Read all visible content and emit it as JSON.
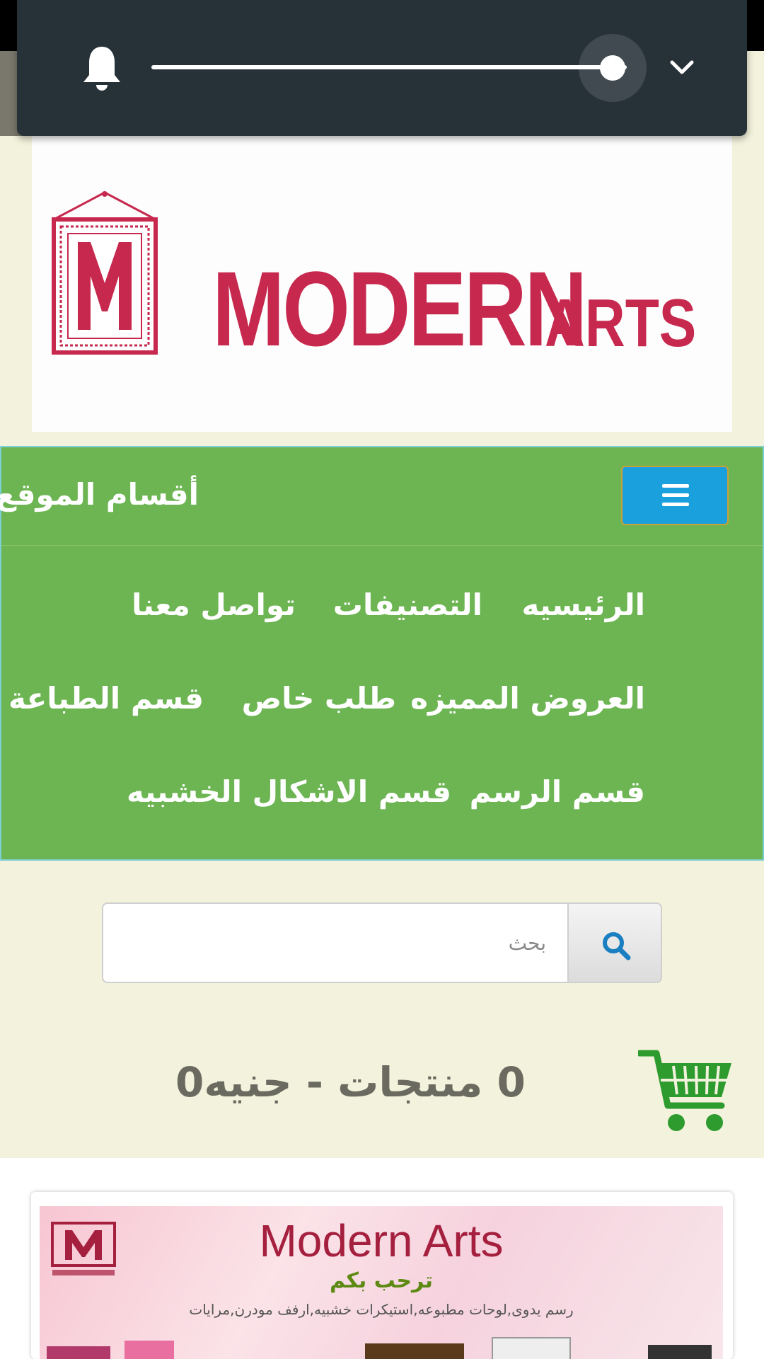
{
  "logo": {
    "word1": "MODERN",
    "word2": "ARTS",
    "letter": "M",
    "color": "#c7284e"
  },
  "nav": {
    "title": "أقسام الموقع",
    "links": [
      "الرئيسيه",
      "التصنيفات",
      "تواصل معنا",
      "العروض المميزه",
      "طلب خاص",
      "قسم الطباعة",
      "قسم الرسم",
      "قسم الاشكال الخشبيه"
    ],
    "bg_color": "#6cb552",
    "menu_button_color": "#1aa0dd"
  },
  "search": {
    "placeholder": "بحث",
    "icon": "search-icon"
  },
  "cart": {
    "summary": "0 منتجات - جنيه0",
    "icon": "shopping-cart-icon",
    "color": "#2e9b2e"
  },
  "banner": {
    "title": "Modern Arts",
    "subtitle": "ترحب بكم",
    "description": "رسم يدوى,لوحات مطبوعه,استيكرات خشبيه,ارفف مودرن,مرايات"
  },
  "volume_panel": {
    "level": 0.94,
    "icons": [
      "bell-icon",
      "chevron-down-icon"
    ]
  }
}
